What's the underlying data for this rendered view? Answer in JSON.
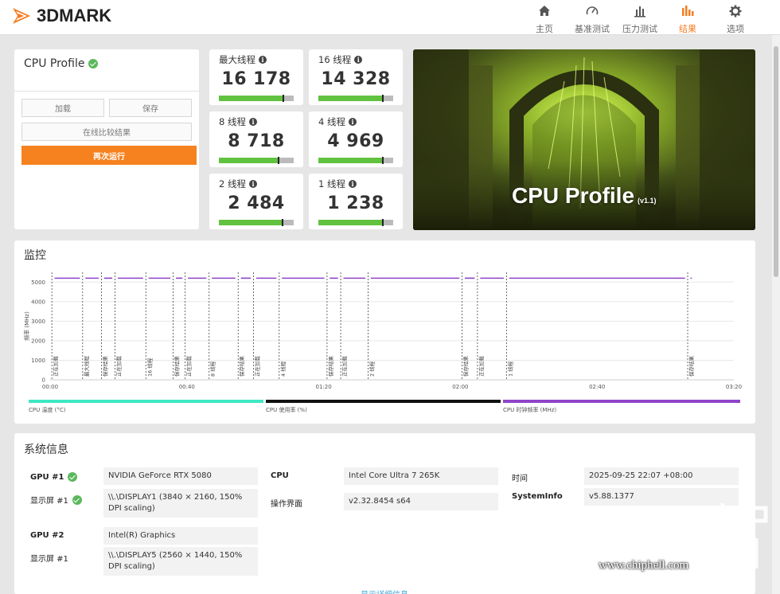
{
  "app": {
    "logo_text": "3DMARK"
  },
  "nav": [
    {
      "label": "主页",
      "icon": "home-icon",
      "active": false
    },
    {
      "label": "基准测试",
      "icon": "gauge-icon",
      "active": false
    },
    {
      "label": "压力测试",
      "icon": "stress-chart-icon",
      "active": false
    },
    {
      "label": "结果",
      "icon": "results-bar-icon",
      "active": true
    },
    {
      "label": "选项",
      "icon": "gear-icon",
      "active": false
    }
  ],
  "profile": {
    "title": "CPU Profile",
    "load_label": "加载",
    "save_label": "保存",
    "compare_label": "在线比较结果",
    "run_label": "再次运行"
  },
  "scores": [
    {
      "label": "最大线程",
      "value": "16 178",
      "fill": 0.86
    },
    {
      "label": "16 线程",
      "value": "14 328",
      "fill": 0.86
    },
    {
      "label": "8 线程",
      "value": "8 718",
      "fill": 0.8
    },
    {
      "label": "4 线程",
      "value": "4 969",
      "fill": 0.86
    },
    {
      "label": "2 线程",
      "value": "2 484",
      "fill": 0.85
    },
    {
      "label": "1 线程",
      "value": "1 238",
      "fill": 0.86
    }
  ],
  "hero": {
    "title": "CPU Profile",
    "version": "(v1.1)"
  },
  "monitor": {
    "title": "监控",
    "legend": [
      {
        "label": "CPU 温度 (°C)",
        "color": "#3de8c4"
      },
      {
        "label": "CPU 使用率 (%)",
        "color": "#111111"
      },
      {
        "label": "CPU 时钟频率 (MHz)",
        "color": "#8e44c9"
      }
    ]
  },
  "chart_data": {
    "type": "line",
    "ylabel": "频率 (MHz)",
    "yticks": [
      "0",
      "1000",
      "2000",
      "3000",
      "4000",
      "5000"
    ],
    "ylim": [
      0,
      5500
    ],
    "xticks": [
      "00:00",
      "00:40",
      "01:20",
      "02:00",
      "02:40",
      "03:20"
    ],
    "xlim": [
      0,
      200
    ],
    "series": [
      {
        "name": "CPU 时钟频率 (MHz)",
        "value": 5200
      }
    ],
    "markers": [
      {
        "t": 0.5,
        "label": "正在加载"
      },
      {
        "t": 9.5,
        "label": "最大线程"
      },
      {
        "t": 15,
        "label": "保存结果"
      },
      {
        "t": 19,
        "label": "正在加载"
      },
      {
        "t": 28,
        "label": "16 线程"
      },
      {
        "t": 36,
        "label": "保存结果"
      },
      {
        "t": 39.5,
        "label": "正在加载"
      },
      {
        "t": 46.5,
        "label": "8 线程"
      },
      {
        "t": 55,
        "label": "保存结果"
      },
      {
        "t": 59.5,
        "label": "正在加载"
      },
      {
        "t": 67,
        "label": "4 线程"
      },
      {
        "t": 81,
        "label": "保存结果"
      },
      {
        "t": 85,
        "label": "正在加载"
      },
      {
        "t": 93,
        "label": "2 线程"
      },
      {
        "t": 120.5,
        "label": "保存结果"
      },
      {
        "t": 125,
        "label": "正在加载"
      },
      {
        "t": 133.5,
        "label": "1 线程"
      },
      {
        "t": 186.5,
        "label": "保存结果"
      }
    ]
  },
  "sysinfo": {
    "title": "系统信息",
    "gpu1_label": "GPU #1",
    "gpu1_value": "NVIDIA GeForce RTX 5080",
    "disp1_label": "显示屏 #1",
    "disp1_value": "\\\\.\\DISPLAY1 (3840 × 2160, 150% DPI scaling)",
    "gpu2_label": "GPU #2",
    "gpu2_value": "Intel(R) Graphics",
    "disp2_label": "显示屏 #1",
    "disp2_value": "\\\\.\\DISPLAY5 (2560 × 1440, 150% DPI scaling)",
    "cpu_label": "CPU",
    "cpu_value": "Intel Core Ultra 7 265K",
    "os_label": "操作界面",
    "os_value": "v2.32.8454 s64",
    "time_label": "时间",
    "time_value": "2025-09-25 22:07 +08:00",
    "sysinfo_label": "SystemInfo",
    "sysinfo_value": "v5.88.1377",
    "more_label": "显示详细信息"
  },
  "watermark": {
    "text": "www.chiphell.com"
  }
}
